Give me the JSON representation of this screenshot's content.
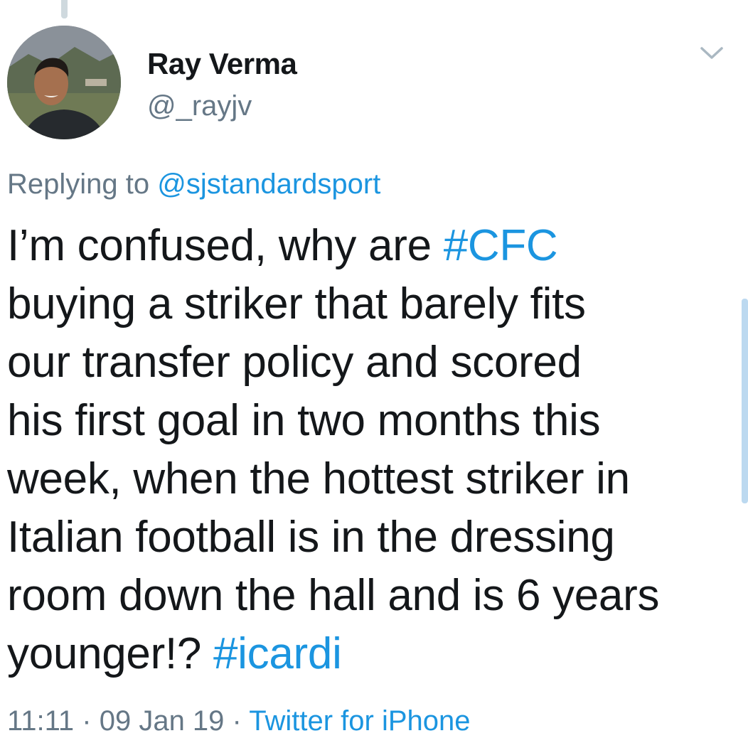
{
  "tweet": {
    "author": {
      "display_name": "Ray Verma",
      "handle": "@_rayjv",
      "avatar_icon": "profile-photo"
    },
    "menu_icon": "chevron-down-icon",
    "reply": {
      "prefix": "Replying to ",
      "mention": "@sjstandardsport"
    },
    "text": {
      "line1_a": "I’m confused, why are ",
      "line1_tag": "#CFC",
      "line2": "buying a striker that barely fits",
      "line3": "our transfer policy and scored",
      "line4": "his first goal in two months this",
      "line5": "week, when the hottest striker in",
      "line6": "Italian football is in the dressing",
      "line7": "room down the hall and is 6 years",
      "line8_a": "younger!? ",
      "line8_tag": "#icardi"
    },
    "meta": {
      "time": "11:11",
      "separator1": " · ",
      "date": "09 Jan 19",
      "separator2": " · ",
      "source": "Twitter for iPhone"
    }
  },
  "colors": {
    "text": "#14171a",
    "secondary": "#657786",
    "link": "#1b95e0",
    "background": "#ffffff"
  }
}
